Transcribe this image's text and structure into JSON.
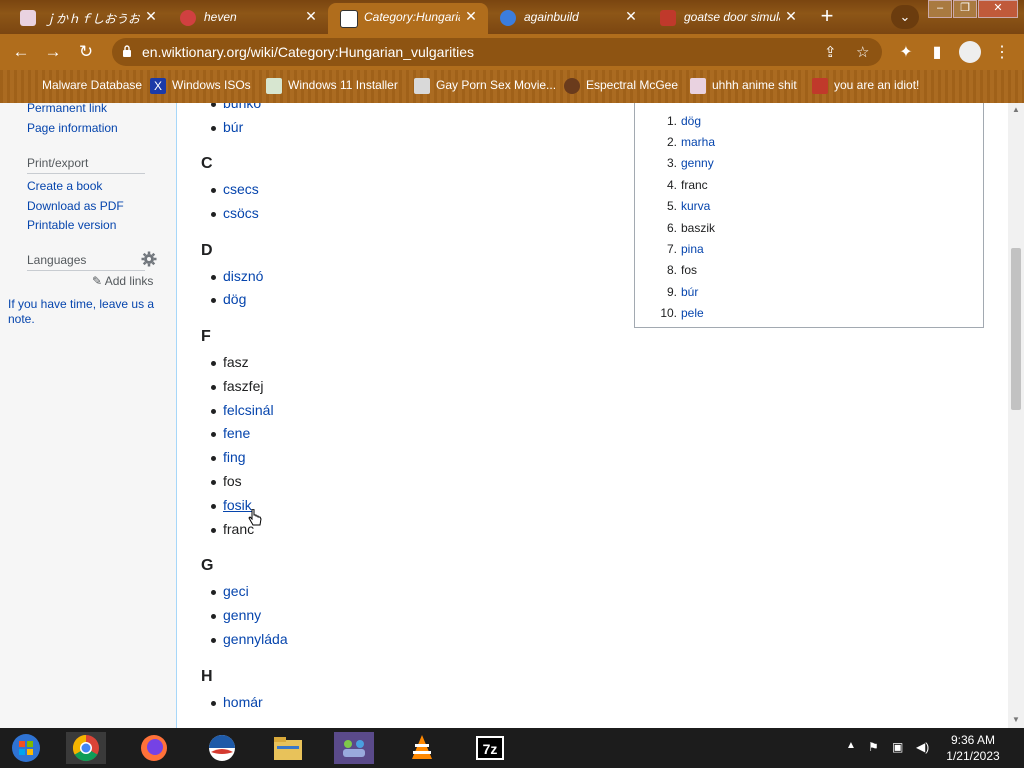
{
  "browser": {
    "tabs": [
      {
        "title": "ｊかｈｆしおうお,あ",
        "active": false
      },
      {
        "title": "heven",
        "active": false
      },
      {
        "title": "Category:Hungarian",
        "active": true
      },
      {
        "title": "againbuild",
        "active": false
      },
      {
        "title": "goatse door simulator",
        "active": false
      }
    ],
    "tab_close": "✕",
    "new_tab": "+",
    "url": "en.wiktionary.org/wiki/Category:Hungarian_vulgarities",
    "bookmarks": [
      "Malware Database",
      "Windows ISOs",
      "Windows 11 Installer",
      "Gay Porn Sex Movie...",
      "Espectral McGee",
      "uhhh anime shit",
      "you are an idiot!"
    ]
  },
  "sidebar": {
    "permanent_link": "Permanent link",
    "page_information": "Page information",
    "print_export_heading": "Print/export",
    "create_book": "Create a book",
    "download_pdf": "Download as PDF",
    "printable_version": "Printable version",
    "languages_heading": "Languages",
    "add_links": "Add links",
    "note": "If you have time, leave us a note."
  },
  "content": {
    "top_partial": "bunkó",
    "sections": [
      {
        "letter": "",
        "words": [
          {
            "text": "búr",
            "link": "blue"
          }
        ]
      },
      {
        "letter": "C",
        "words": [
          {
            "text": "csecs",
            "link": "blue"
          },
          {
            "text": "csöcs",
            "link": "blue"
          }
        ]
      },
      {
        "letter": "D",
        "words": [
          {
            "text": "disznó",
            "link": "blue"
          },
          {
            "text": "dög",
            "link": "blue"
          }
        ]
      },
      {
        "letter": "F",
        "words": [
          {
            "text": "fasz",
            "link": "black"
          },
          {
            "text": "faszfej",
            "link": "black"
          },
          {
            "text": "felcsinál",
            "link": "blue"
          },
          {
            "text": "fene",
            "link": "blue"
          },
          {
            "text": "fing",
            "link": "blue"
          },
          {
            "text": "fos",
            "link": "black"
          },
          {
            "text": "fosik",
            "link": "blue"
          },
          {
            "text": "franc",
            "link": "black"
          }
        ]
      },
      {
        "letter": "G",
        "words": [
          {
            "text": "geci",
            "link": "blue"
          },
          {
            "text": "genny",
            "link": "blue"
          },
          {
            "text": "gennyláda",
            "link": "blue"
          }
        ]
      },
      {
        "letter": "H",
        "words": [
          {
            "text": "homár",
            "link": "blue"
          }
        ]
      }
    ]
  },
  "top_list": [
    {
      "num": "1.",
      "word": "dög",
      "link": "blue"
    },
    {
      "num": "2.",
      "word": "marha",
      "link": "blue"
    },
    {
      "num": "3.",
      "word": "genny",
      "link": "blue"
    },
    {
      "num": "4.",
      "word": "franc",
      "link": "black"
    },
    {
      "num": "5.",
      "word": "kurva",
      "link": "blue"
    },
    {
      "num": "6.",
      "word": "baszik",
      "link": "black"
    },
    {
      "num": "7.",
      "word": "pina",
      "link": "blue"
    },
    {
      "num": "8.",
      "word": "fos",
      "link": "black"
    },
    {
      "num": "9.",
      "word": "búr",
      "link": "blue"
    },
    {
      "num": "10.",
      "word": "pele",
      "link": "blue"
    }
  ],
  "taskbar": {
    "time": "9:36 AM",
    "date": "1/21/2023",
    "apps": [
      "start-icon",
      "chrome-icon",
      "firefox-icon",
      "obama-icon",
      "file-explorer-icon",
      "network-people-icon",
      "vlc-icon",
      "7zip-icon"
    ]
  },
  "colors": {
    "link": "#0645ad",
    "text": "#202122",
    "chrome_accent": "#b06d1c"
  }
}
